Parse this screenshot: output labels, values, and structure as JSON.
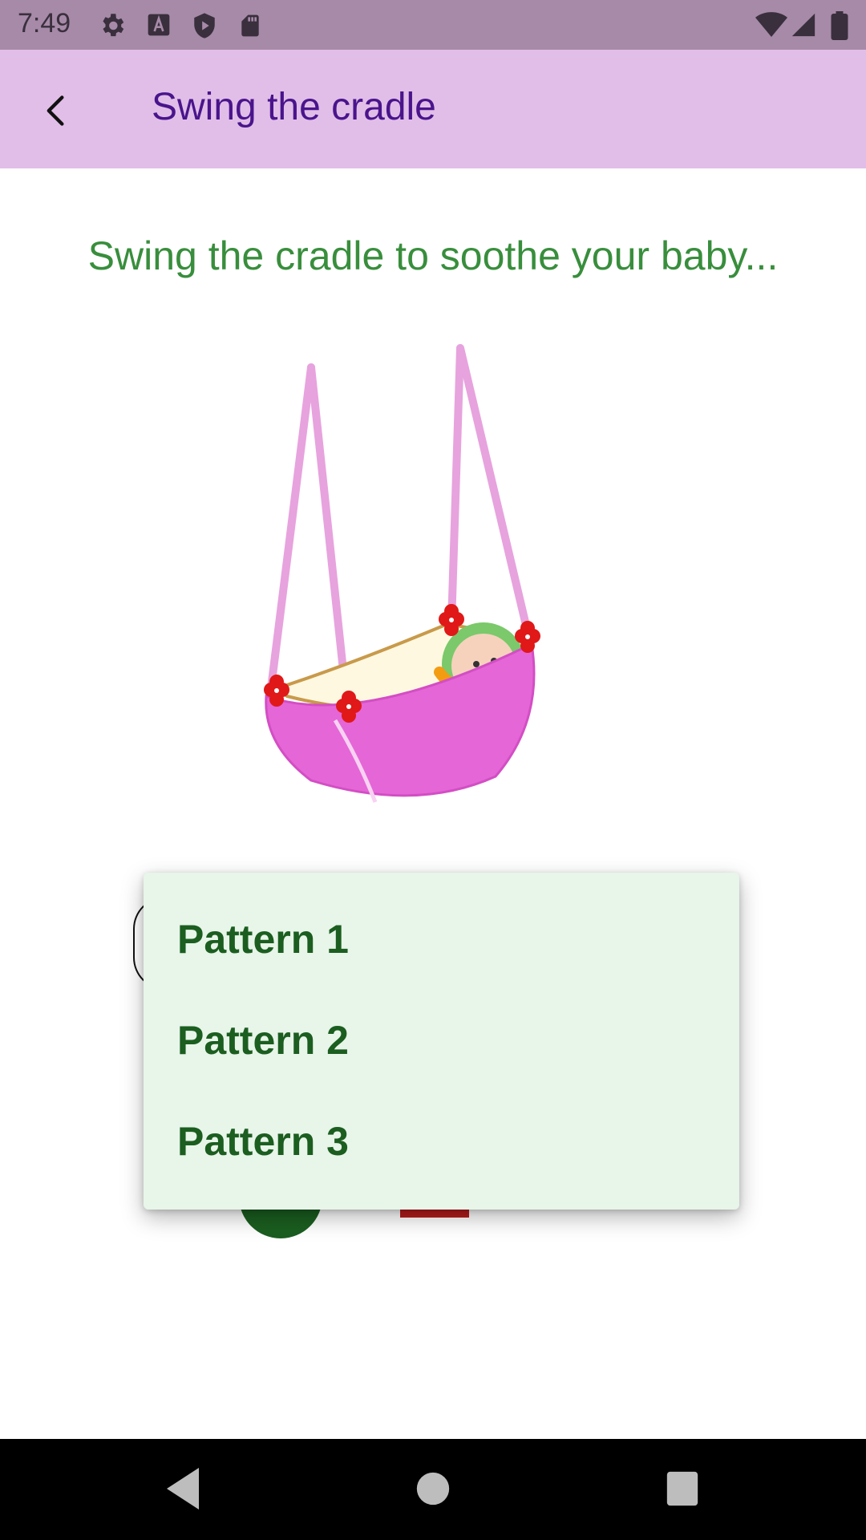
{
  "status_bar": {
    "time": "7:49",
    "icons_left": [
      "settings-icon",
      "a-icon",
      "shield-icon",
      "sd-card-icon"
    ],
    "icons_right": [
      "wifi-icon",
      "signal-icon",
      "battery-icon"
    ]
  },
  "app_bar": {
    "title": "Swing the cradle",
    "back_icon": "arrow-back-icon"
  },
  "main": {
    "subtitle": "Swing the cradle to soothe your baby..."
  },
  "dropdown": {
    "items": [
      {
        "label": "Pattern 1"
      },
      {
        "label": "Pattern 2"
      },
      {
        "label": "Pattern 3"
      }
    ]
  },
  "colors": {
    "status_bar": "#a68aa8",
    "app_bar": "#e1bee7",
    "title": "#4a148c",
    "subtitle": "#388e3c",
    "menu_bg": "#e8f5e9",
    "menu_text": "#1b5e20"
  },
  "nav_bar": {
    "icons": [
      "back-triangle-icon",
      "home-circle-icon",
      "recents-square-icon"
    ]
  }
}
